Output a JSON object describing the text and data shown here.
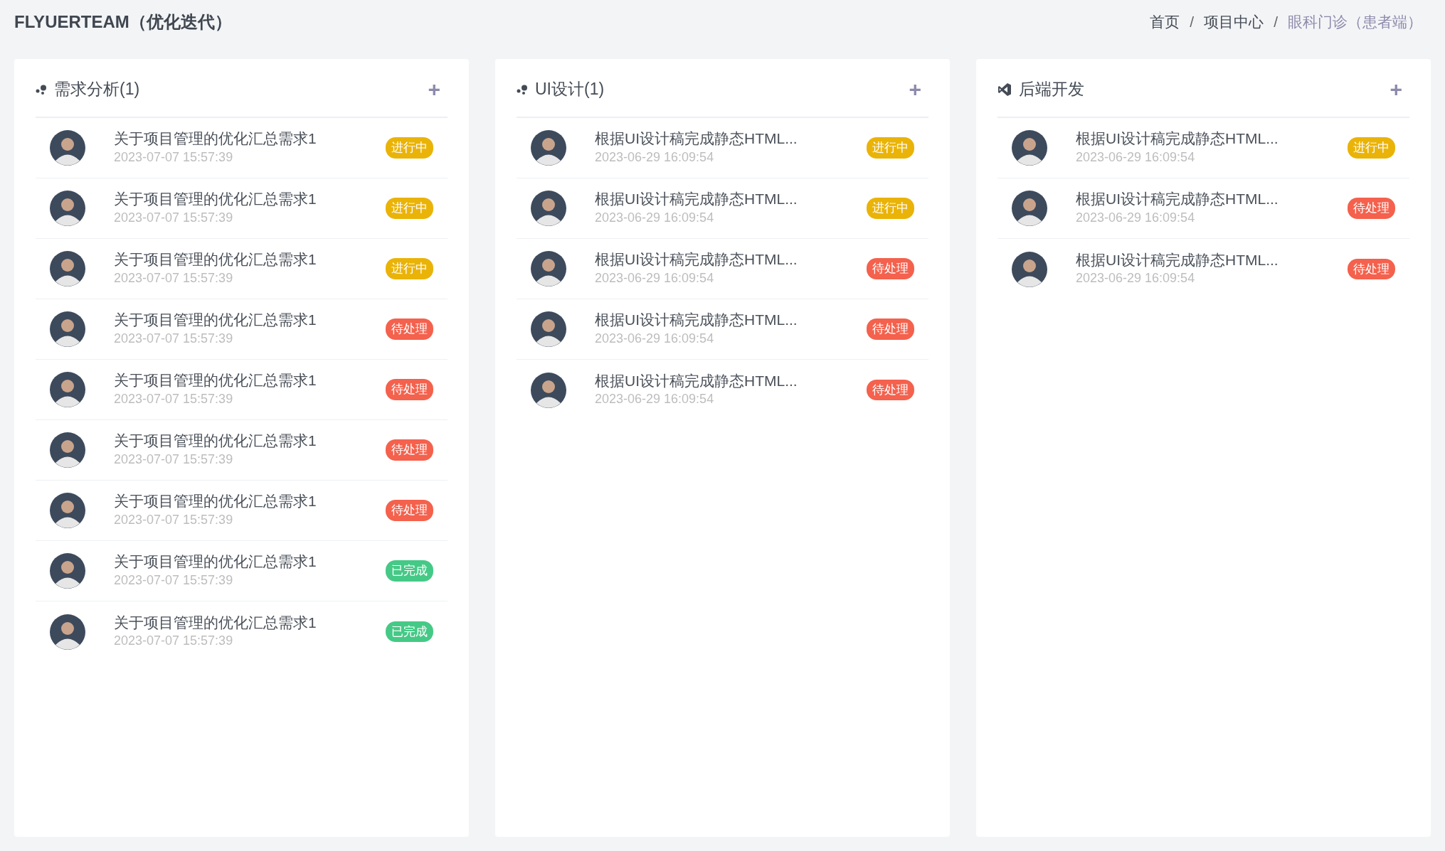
{
  "title": "FLYUERTEAM（优化迭代）",
  "breadcrumb": [
    {
      "label": "首页",
      "current": false
    },
    {
      "label": "项目中心",
      "current": false
    },
    {
      "label": "眼科门诊（患者端）",
      "current": true
    }
  ],
  "breadcrumb_separator": "/",
  "columns": [
    {
      "title": "需求分析(1)",
      "kind": "dots",
      "add": "+",
      "tasks": [
        {
          "title": "关于项目管理的优化汇总需求1",
          "time": "2023-07-07 15:57:39",
          "status": "进行中",
          "kind": "progress"
        },
        {
          "title": "关于项目管理的优化汇总需求1",
          "time": "2023-07-07 15:57:39",
          "status": "进行中",
          "kind": "progress"
        },
        {
          "title": "关于项目管理的优化汇总需求1",
          "time": "2023-07-07 15:57:39",
          "status": "进行中",
          "kind": "progress"
        },
        {
          "title": "关于项目管理的优化汇总需求1",
          "time": "2023-07-07 15:57:39",
          "status": "待处理",
          "kind": "pending"
        },
        {
          "title": "关于项目管理的优化汇总需求1",
          "time": "2023-07-07 15:57:39",
          "status": "待处理",
          "kind": "pending"
        },
        {
          "title": "关于项目管理的优化汇总需求1",
          "time": "2023-07-07 15:57:39",
          "status": "待处理",
          "kind": "pending"
        },
        {
          "title": "关于项目管理的优化汇总需求1",
          "time": "2023-07-07 15:57:39",
          "status": "待处理",
          "kind": "pending"
        },
        {
          "title": "关于项目管理的优化汇总需求1",
          "time": "2023-07-07 15:57:39",
          "status": "已完成",
          "kind": "done"
        },
        {
          "title": "关于项目管理的优化汇总需求1",
          "time": "2023-07-07 15:57:39",
          "status": "已完成",
          "kind": "done"
        }
      ]
    },
    {
      "title": "UI设计(1)",
      "kind": "dots",
      "add": "+",
      "tasks": [
        {
          "title": "根据UI设计稿完成静态HTML...",
          "time": "2023-06-29 16:09:54",
          "status": "进行中",
          "kind": "progress"
        },
        {
          "title": "根据UI设计稿完成静态HTML...",
          "time": "2023-06-29 16:09:54",
          "status": "进行中",
          "kind": "progress"
        },
        {
          "title": "根据UI设计稿完成静态HTML...",
          "time": "2023-06-29 16:09:54",
          "status": "待处理",
          "kind": "pending"
        },
        {
          "title": "根据UI设计稿完成静态HTML...",
          "time": "2023-06-29 16:09:54",
          "status": "待处理",
          "kind": "pending"
        },
        {
          "title": "根据UI设计稿完成静态HTML...",
          "time": "2023-06-29 16:09:54",
          "status": "待处理",
          "kind": "pending"
        }
      ]
    },
    {
      "title": "后端开发",
      "kind": "code",
      "add": "+",
      "tasks": [
        {
          "title": "根据UI设计稿完成静态HTML...",
          "time": "2023-06-29 16:09:54",
          "status": "进行中",
          "kind": "progress"
        },
        {
          "title": "根据UI设计稿完成静态HTML...",
          "time": "2023-06-29 16:09:54",
          "status": "待处理",
          "kind": "pending"
        },
        {
          "title": "根据UI设计稿完成静态HTML...",
          "time": "2023-06-29 16:09:54",
          "status": "待处理",
          "kind": "pending"
        }
      ]
    }
  ]
}
